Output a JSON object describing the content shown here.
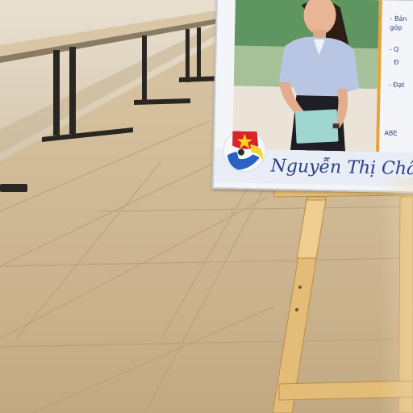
{
  "poster": {
    "name": "Nguyễn Thị Châu",
    "side_lines": [
      "- Bản",
      "góp",
      "- Q",
      "Đ",
      "- Đạt",
      "ABE"
    ]
  },
  "colors": {
    "floor": "#cdb796",
    "wall": "#e2d7c4",
    "poster_name": "#2a3f86",
    "easel_wood": "#e8c47f"
  }
}
